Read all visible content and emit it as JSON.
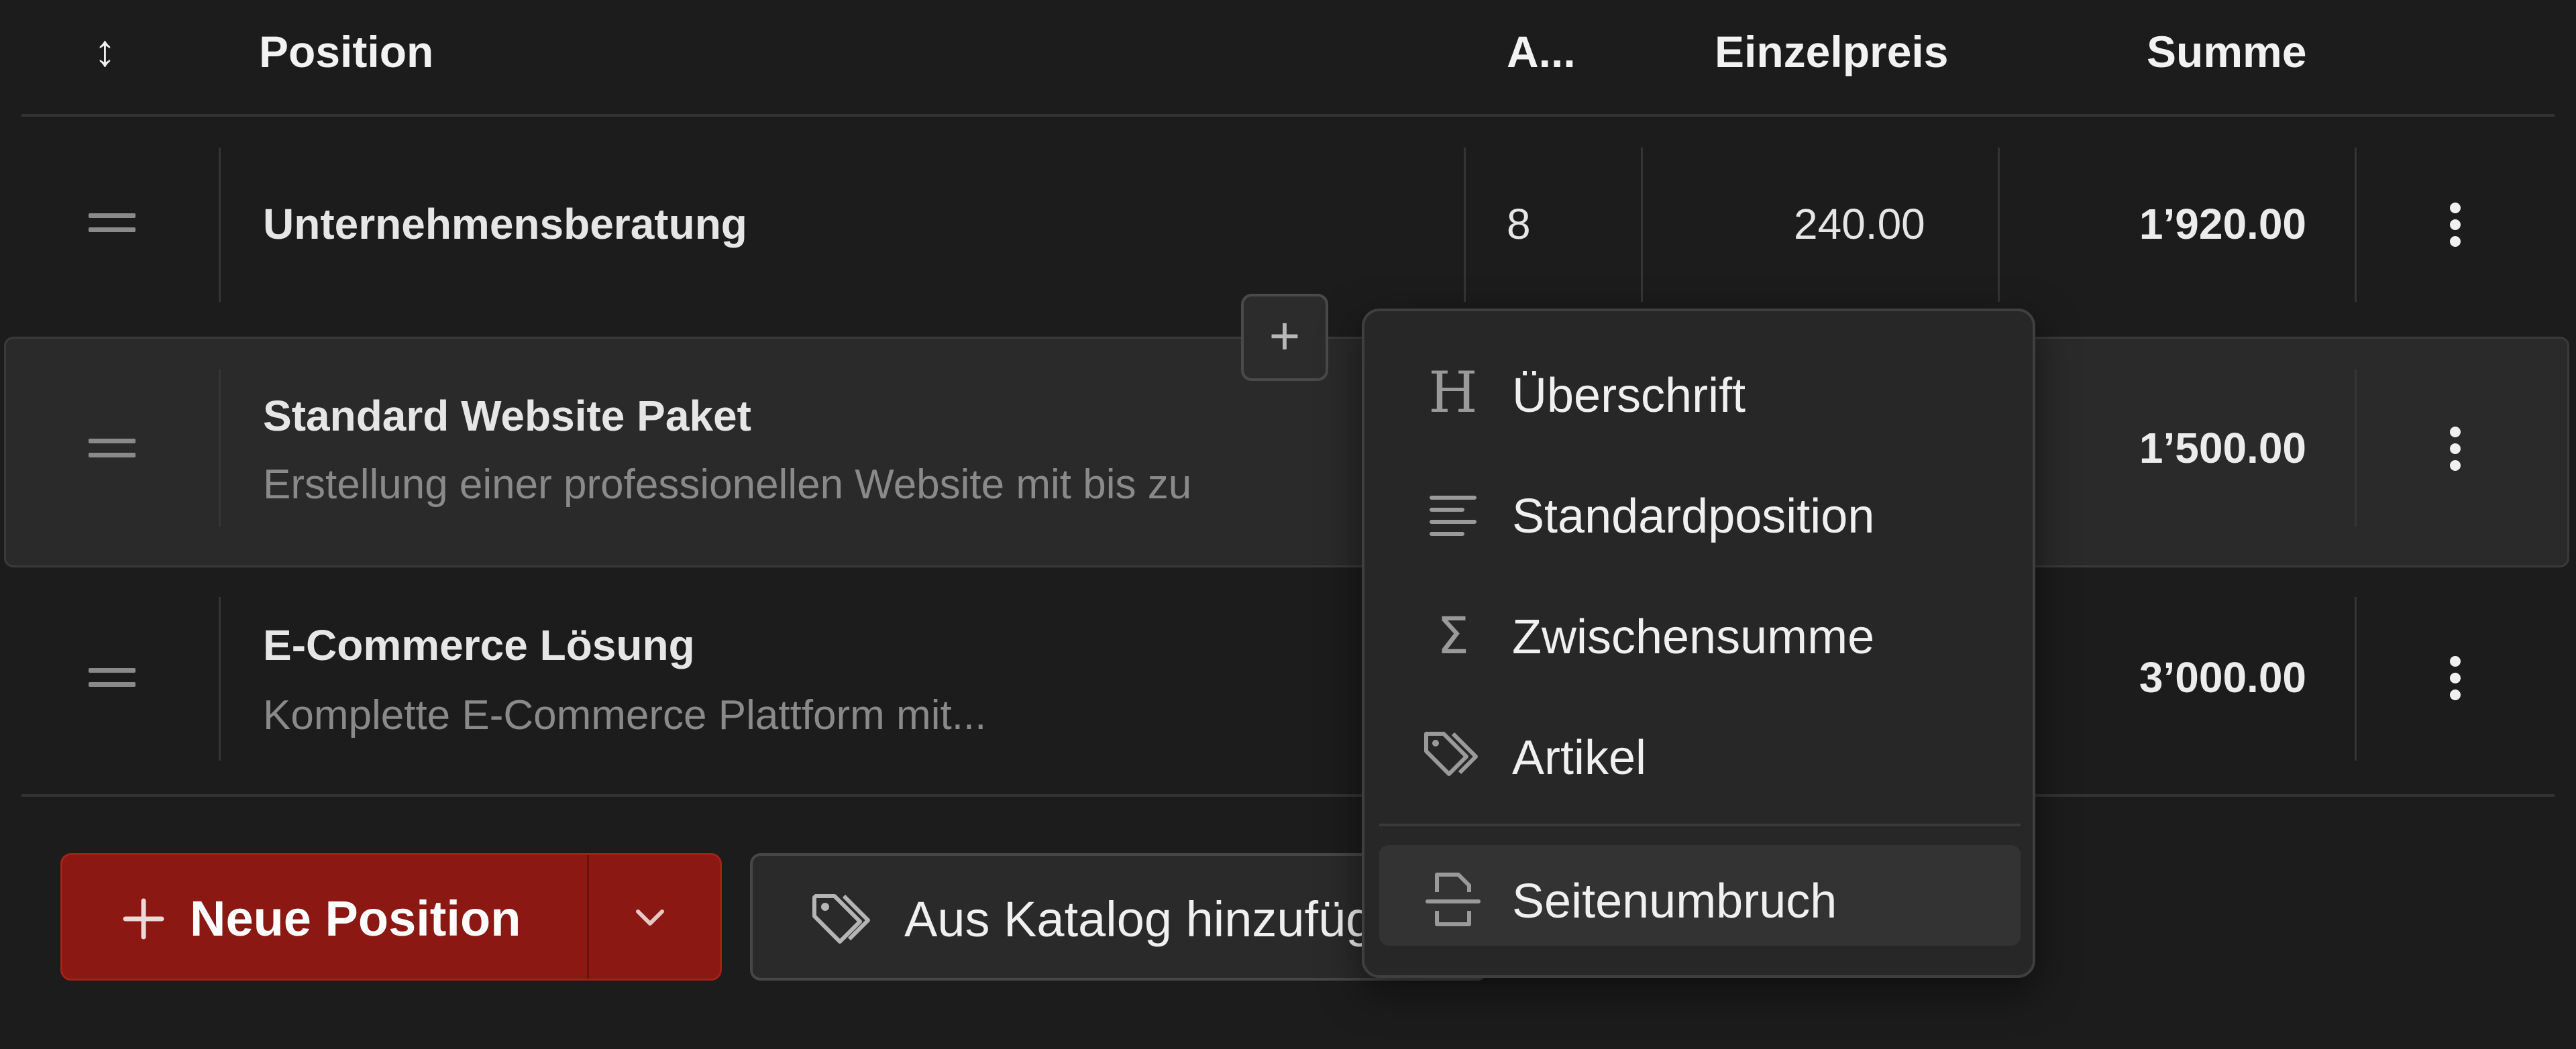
{
  "table": {
    "headers": {
      "sort": "↕",
      "position": "Position",
      "amount": "A...",
      "unit_price": "Einzelpreis",
      "total": "Summe"
    },
    "rows": [
      {
        "title": "Unternehmensberatung",
        "description": "",
        "amount": "8",
        "unit_price": "240.00",
        "total": "1’920.00"
      },
      {
        "title": "Standard Website Paket",
        "description": "Erstellung einer professionellen Website mit bis zu",
        "amount": "",
        "unit_price": "",
        "total": "1’500.00"
      },
      {
        "title": "E-Commerce Lösung",
        "description": "Komplette E-Commerce Plattform mit...",
        "amount": "",
        "unit_price": "",
        "total": "3’000.00"
      }
    ]
  },
  "insert_menu": {
    "items": [
      {
        "icon": "heading-icon",
        "label": "Überschrift"
      },
      {
        "icon": "lines-icon",
        "label": "Standardposition"
      },
      {
        "icon": "sigma-icon",
        "label": "Zwischensumme"
      },
      {
        "icon": "tag-icon",
        "label": "Artikel"
      },
      {
        "icon": "page-break-icon",
        "label": "Seitenumbruch"
      }
    ],
    "highlighted": "Seitenumbruch"
  },
  "actions": {
    "new_position": "Neue Position",
    "from_catalog": "Aus Katalog hinzufügen"
  },
  "colors": {
    "background": "#1c1c1c",
    "primary": "#8b1812",
    "menu_bg": "#272727"
  }
}
